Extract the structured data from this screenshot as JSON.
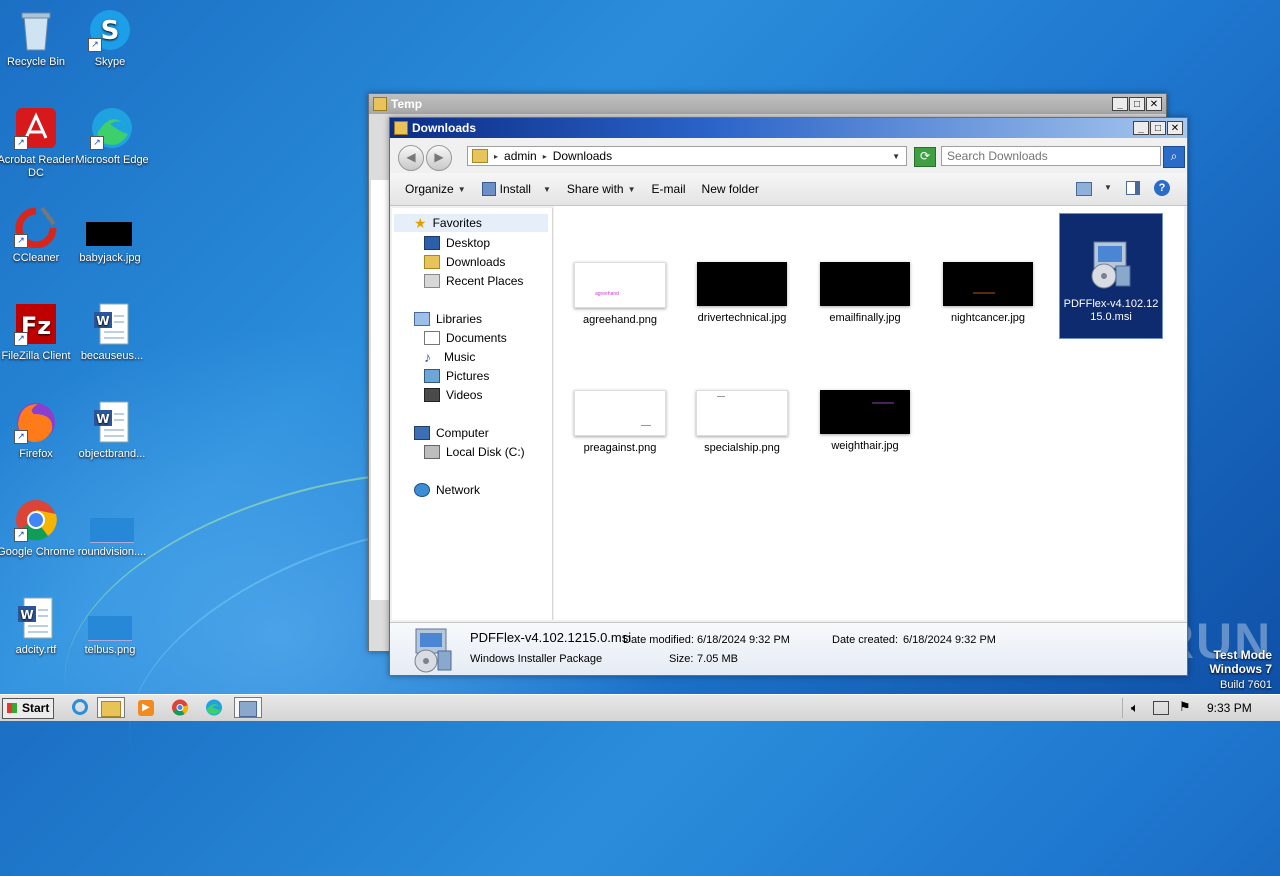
{
  "desktop": {
    "icons": [
      {
        "label": "Recycle Bin"
      },
      {
        "label": "Skype"
      },
      {
        "label": "Acrobat Reader DC"
      },
      {
        "label": "Microsoft Edge"
      },
      {
        "label": "CCleaner"
      },
      {
        "label": "babyjack.jpg"
      },
      {
        "label": "FileZilla Client"
      },
      {
        "label": "becauseus..."
      },
      {
        "label": "Firefox"
      },
      {
        "label": "objectbrand..."
      },
      {
        "label": "Google Chrome"
      },
      {
        "label": "roundvision...."
      },
      {
        "label": "adcity.rtf"
      },
      {
        "label": "telbus.png"
      }
    ],
    "watermark": {
      "test_mode": "Test Mode",
      "os": "Windows 7",
      "build": "Build 7601",
      "brand": "ANY.RUN"
    }
  },
  "temp_window": {
    "title": "Temp"
  },
  "downloads_window": {
    "title": "Downloads",
    "breadcrumb": [
      "admin",
      "Downloads"
    ],
    "search_placeholder": "Search Downloads",
    "toolbar": {
      "organize": "Organize",
      "install": "Install",
      "share_with": "Share with",
      "email": "E-mail",
      "new_folder": "New folder"
    },
    "nav": {
      "favorites": "Favorites",
      "desktop": "Desktop",
      "downloads": "Downloads",
      "recent_places": "Recent Places",
      "libraries": "Libraries",
      "documents": "Documents",
      "music": "Music",
      "pictures": "Pictures",
      "videos": "Videos",
      "computer": "Computer",
      "local_disk": "Local Disk (C:)",
      "network": "Network"
    },
    "files": [
      {
        "name": "agreehand.png",
        "thumb_color": "#ffffff",
        "thumb_text": "agreehand"
      },
      {
        "name": "drivertechnical.jpg",
        "thumb_color": "#000000"
      },
      {
        "name": "emailfinally.jpg",
        "thumb_color": "#000000"
      },
      {
        "name": "nightcancer.jpg",
        "thumb_color": "#000000"
      },
      {
        "name": "PDFFlex-v4.102.1215.0.msi",
        "selected": true
      },
      {
        "name": "preagainst.png",
        "thumb_color": "#ffffff"
      },
      {
        "name": "specialship.png",
        "thumb_color": "#ffffff"
      },
      {
        "name": "weighthair.jpg",
        "thumb_color": "#000000"
      }
    ],
    "details": {
      "filename": "PDFFlex-v4.102.1215.0.msi",
      "type": "Windows Installer Package",
      "date_modified_label": "Date modified:",
      "date_modified": "6/18/2024 9:32 PM",
      "size_label": "Size:",
      "size": "7.05 MB",
      "date_created_label": "Date created:",
      "date_created": "6/18/2024 9:32 PM"
    }
  },
  "taskbar": {
    "start": "Start",
    "clock": "9:33 PM"
  }
}
